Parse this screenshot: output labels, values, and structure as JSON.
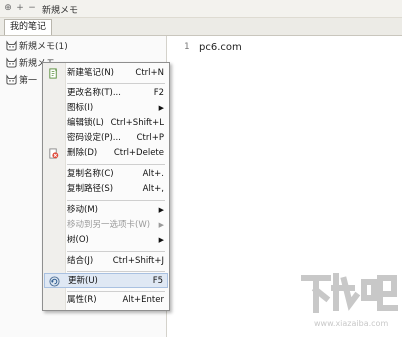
{
  "window": {
    "title": "新規メモ"
  },
  "tabs": [
    {
      "label": "我的笔记"
    }
  ],
  "notes": [
    {
      "label": "新規メモ(1)"
    },
    {
      "label": "新規メモ"
    },
    {
      "label": "第一"
    }
  ],
  "editor": {
    "line_number": "1",
    "text": "pc6.com"
  },
  "menu": {
    "items": [
      {
        "label": "新建笔记(N)",
        "shortcut": "Ctrl+N",
        "icon": "new-note-icon"
      },
      {
        "label": "更改名称(T)...",
        "shortcut": "F2"
      },
      {
        "label": "图标(I)",
        "submenu": true
      },
      {
        "label": "编辑锁(L)",
        "shortcut": "Ctrl+Shift+L"
      },
      {
        "label": "密码设定(P)...",
        "shortcut": "Ctrl+P"
      },
      {
        "label": "删除(D)",
        "shortcut": "Ctrl+Delete",
        "icon": "delete-icon"
      },
      {
        "label": "复制名称(C)",
        "shortcut": "Alt+."
      },
      {
        "label": "复制路径(S)",
        "shortcut": "Alt+,"
      },
      {
        "label": "移动(M)",
        "submenu": true
      },
      {
        "label": "移动到另一选项卡(W)",
        "submenu": true,
        "disabled": true
      },
      {
        "label": "树(O)",
        "submenu": true
      },
      {
        "label": "结合(J)",
        "shortcut": "Ctrl+Shift+J"
      },
      {
        "label": "更新(U)",
        "shortcut": "F5",
        "icon": "refresh-icon",
        "highlighted": true
      },
      {
        "label": "属性(R)",
        "shortcut": "Alt+Enter"
      }
    ],
    "submenu_arrow": "▶"
  },
  "watermark": {
    "text": "下载吧",
    "url": "www.xiazaiba.com"
  },
  "colors": {
    "menu_highlight": "#dfe8f4",
    "menu_border": "#8f8f8f"
  }
}
